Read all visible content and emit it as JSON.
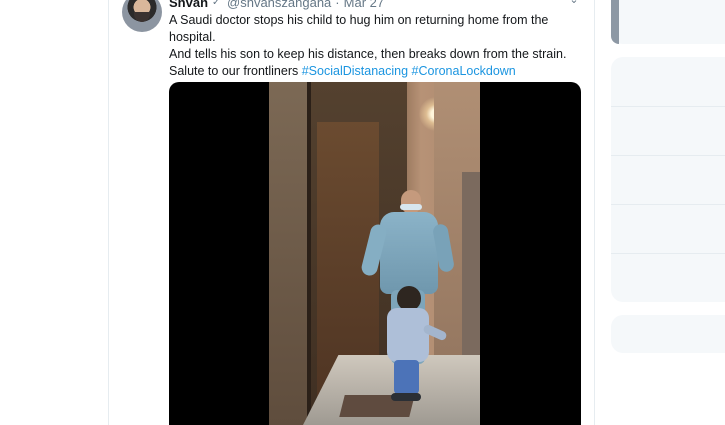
{
  "tweet": {
    "author_name": "Shvan",
    "handle": "@shvanszangana",
    "separator": "·",
    "date": "Mar 27",
    "text_lines": [
      "A Saudi doctor stops his child to hug him on returning home from the hospital.",
      "And tells his son to keep his distance, then breaks down from the strain."
    ],
    "salute_text": "Salute to our frontliners ",
    "hashtags": [
      "#SocialDistanacing",
      "#CoronaLockdown"
    ]
  },
  "icons": {
    "verified": "verified-icon",
    "caret": "chevron-down-icon",
    "avatar": "avatar"
  },
  "colors": {
    "accent": "#1b95e0",
    "text_primary": "#14171a",
    "text_secondary": "#657786",
    "divider": "#e6ecf0",
    "panel": "#f5f8fa"
  }
}
